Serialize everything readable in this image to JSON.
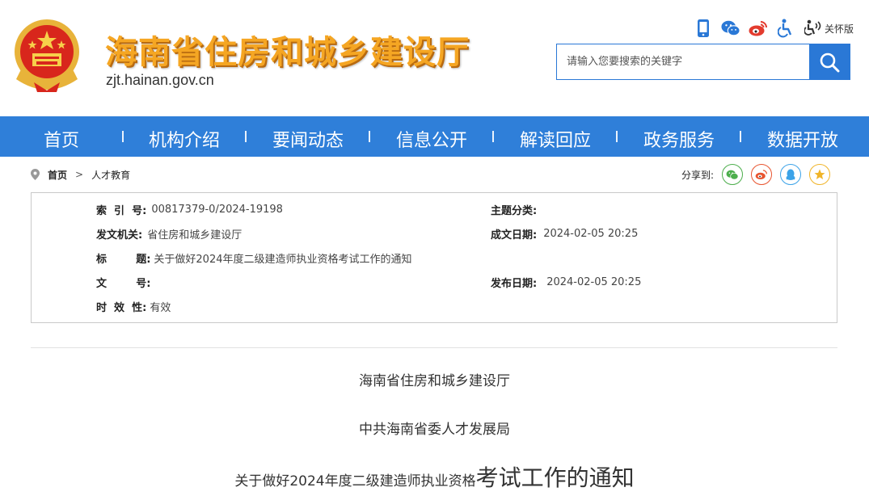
{
  "header": {
    "site_title": "海南省住房和城乡建设厅",
    "domain": "zjt.hainan.gov.cn",
    "care_mode_label": "关怀版",
    "icons": [
      "mobile-icon",
      "wechat-icon",
      "weibo-icon",
      "accessibility-icon",
      "care-mode-icon"
    ],
    "search": {
      "placeholder": "请输入您要搜索的关键字",
      "value": ""
    }
  },
  "nav": {
    "items": [
      "首页",
      "机构介绍",
      "要闻动态",
      "信息公开",
      "解读回应",
      "政务服务",
      "数据开放"
    ]
  },
  "breadcrumb": {
    "home": "首页",
    "separator": ">",
    "current": "人才教育"
  },
  "share": {
    "label": "分享到:",
    "targets": [
      "wechat",
      "weibo",
      "qq",
      "favorite"
    ]
  },
  "meta": {
    "index_no": {
      "label": "索  引  号:",
      "value": "00817379-0/2024-19198"
    },
    "issuer": {
      "label": "发文机关:",
      "value": "省住房和城乡建设厅"
    },
    "title": {
      "label": "标        题:",
      "value": "关于做好2024年度二级建造师执业资格考试工作的通知"
    },
    "doc_no": {
      "label": "文        号:",
      "value": ""
    },
    "validity": {
      "label": "时  效  性:",
      "value": "有效"
    },
    "subject": {
      "label": "主题分类:",
      "value": ""
    },
    "created": {
      "label": "成文日期:",
      "value": "2024-02-05 20:25"
    },
    "published": {
      "label": "发布日期:",
      "value": "2024-02-05 20:25"
    }
  },
  "article": {
    "issuer_1": "海南省住房和城乡建设厅",
    "issuer_2": "中共海南省委人才发展局",
    "title_part_1": "关于做好2024年度二级建造师执业资格",
    "title_part_2": "考试工作的通知"
  },
  "colors": {
    "nav_bg": "#2f7fd9",
    "title_gold": "#f5a623",
    "search_blue": "#2a78d6"
  }
}
